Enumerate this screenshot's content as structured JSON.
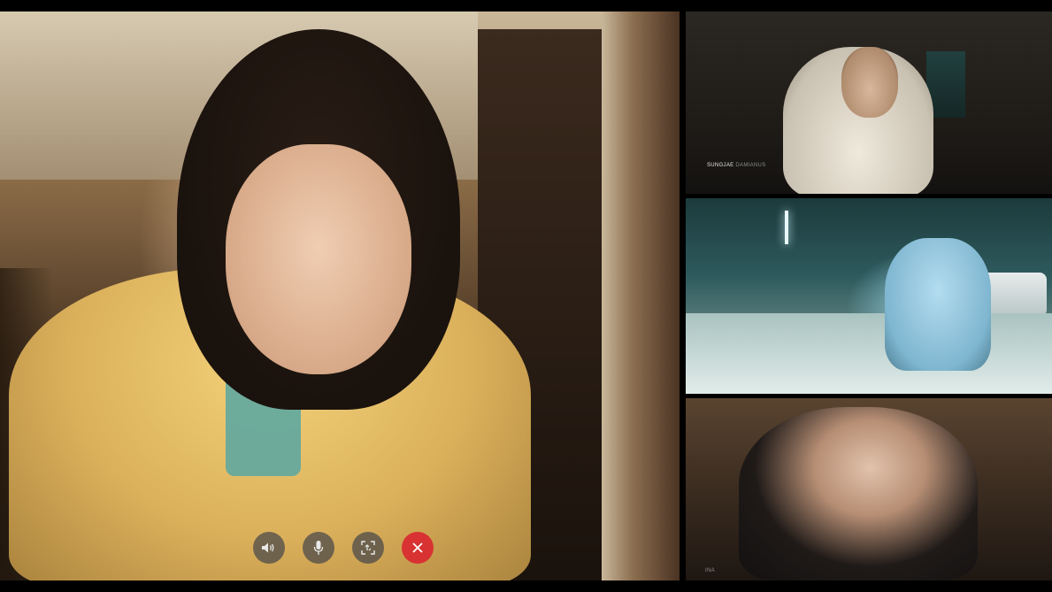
{
  "call": {
    "participants": [
      {
        "first_name": "SUNGJAE",
        "last_name": "DAMIANUS"
      },
      {
        "first_name": "",
        "last_name": ""
      },
      {
        "first_name": "",
        "last_name": "INA"
      }
    ]
  },
  "controls": [
    {
      "id": "speaker",
      "icon": "speaker-icon"
    },
    {
      "id": "microphone",
      "icon": "microphone-icon"
    },
    {
      "id": "switch-camera",
      "icon": "switch-camera-icon"
    },
    {
      "id": "end-call",
      "icon": "close-icon",
      "color": "#d83232"
    }
  ],
  "colors": {
    "background": "#000000",
    "end_call": "#d83232",
    "control_button": "#46464a"
  }
}
